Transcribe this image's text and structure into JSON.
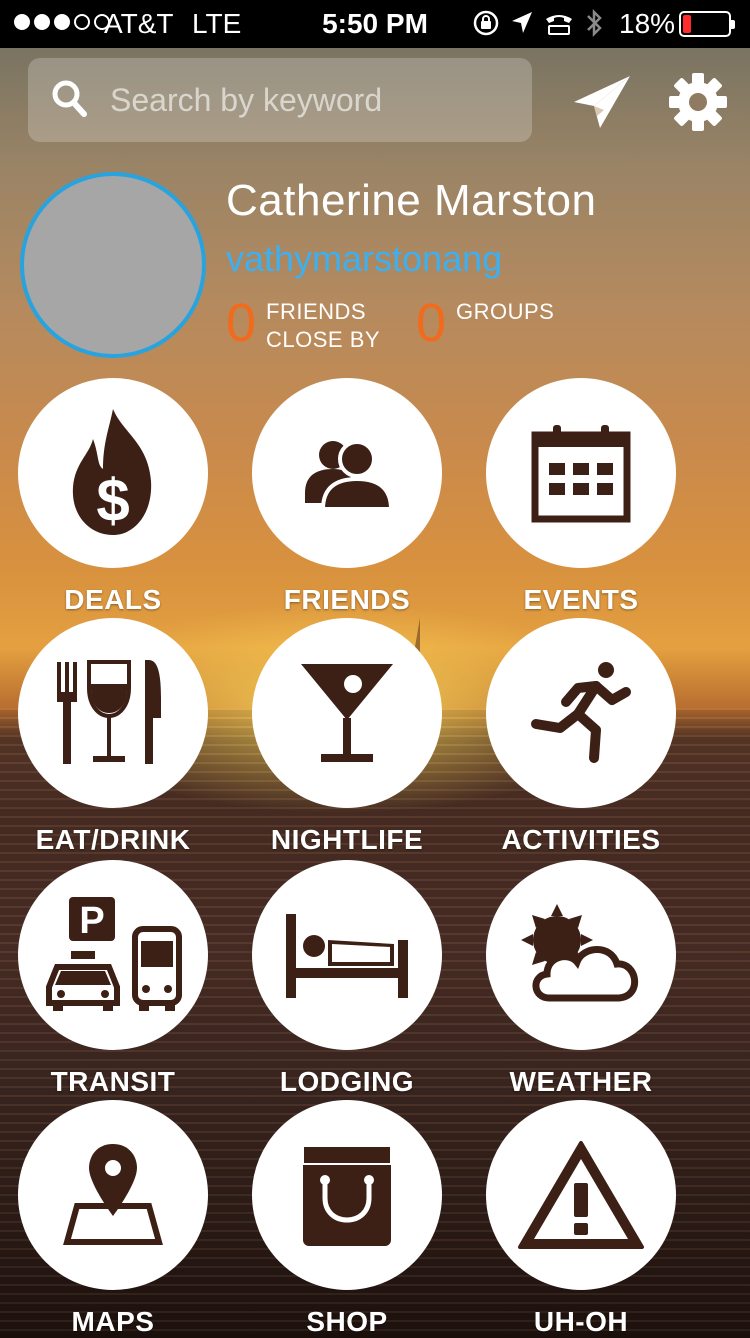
{
  "status_bar": {
    "carrier": "AT&T",
    "network": "LTE",
    "time": "5:50 PM",
    "battery_percent": "18%",
    "battery_level": 0.18,
    "signal_bars": 3
  },
  "search": {
    "placeholder": "Search by keyword"
  },
  "profile": {
    "name": "Catherine  Marston",
    "username": "vathymarstonang",
    "friends_count": "0",
    "friends_label_1": "FRIENDS",
    "friends_label_2": "CLOSE BY",
    "groups_count": "0",
    "groups_label": "GROUPS"
  },
  "colors": {
    "accent_blue": "#3cb0f0",
    "count_orange": "#f26a1b",
    "icon_brown": "#3d2015",
    "battery_low": "#ff2d2d"
  },
  "tiles": [
    {
      "label": "DEALS",
      "icon": "fire-dollar-icon"
    },
    {
      "label": "FRIENDS",
      "icon": "people-icon"
    },
    {
      "label": "EVENTS",
      "icon": "calendar-icon"
    },
    {
      "label": "EAT/DRINK",
      "icon": "utensils-wine-icon"
    },
    {
      "label": "NIGHTLIFE",
      "icon": "cocktail-icon"
    },
    {
      "label": "ACTIVITIES",
      "icon": "runner-icon"
    },
    {
      "label": "TRANSIT",
      "icon": "parking-taxi-bus-icon"
    },
    {
      "label": "LODGING",
      "icon": "bed-icon"
    },
    {
      "label": "WEATHER",
      "icon": "sun-cloud-icon"
    },
    {
      "label": "MAPS",
      "icon": "map-pin-icon"
    },
    {
      "label": "SHOP",
      "icon": "shopping-bag-icon"
    },
    {
      "label": "UH-OH",
      "icon": "warning-icon"
    }
  ]
}
